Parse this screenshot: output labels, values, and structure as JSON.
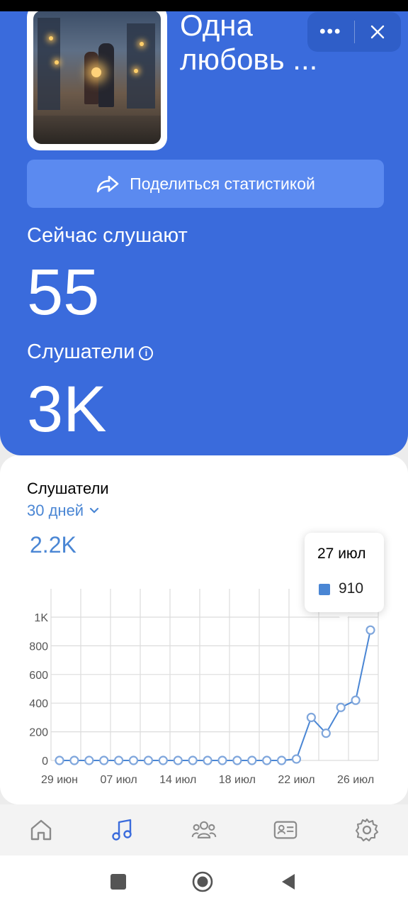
{
  "track": {
    "title": "Одна\nлюбовь ..."
  },
  "window_controls": {
    "more_icon": "more-dots-icon",
    "close_icon": "close-icon"
  },
  "share": {
    "label": "Поделиться статистикой",
    "icon": "share-arrow-icon"
  },
  "now_listening": {
    "label": "Сейчас слушают",
    "value": "55"
  },
  "listeners": {
    "label": "Слушатели",
    "value": "3K"
  },
  "card": {
    "title": "Слушатели",
    "period": "30 дней",
    "total": "2.2K"
  },
  "tooltip": {
    "date": "27 июл",
    "value": "910"
  },
  "colors": {
    "accent": "#3a6bdc",
    "line": "#4a86d4"
  },
  "chart_data": {
    "type": "line",
    "ylim": [
      0,
      1000
    ],
    "y_ticks": [
      "0",
      "200",
      "400",
      "600",
      "800",
      "1K"
    ],
    "x_tick_labels": [
      "29 июн",
      "07 июл",
      "14 июл",
      "18 июл",
      "22 июл",
      "26 июл"
    ],
    "x_tick_indices": [
      0,
      4,
      8,
      12,
      16,
      20
    ],
    "series": [
      {
        "values": [
          0,
          0,
          0,
          0,
          0,
          0,
          0,
          0,
          0,
          0,
          0,
          0,
          0,
          0,
          0,
          0,
          10,
          300,
          190,
          370,
          420,
          910
        ]
      }
    ],
    "grid": true
  },
  "nav": [
    {
      "name": "home-icon"
    },
    {
      "name": "music-icon"
    },
    {
      "name": "audience-icon"
    },
    {
      "name": "profile-card-icon"
    },
    {
      "name": "settings-icon"
    }
  ],
  "system_nav": [
    "recents-square-icon",
    "home-circle-icon",
    "back-triangle-icon"
  ]
}
